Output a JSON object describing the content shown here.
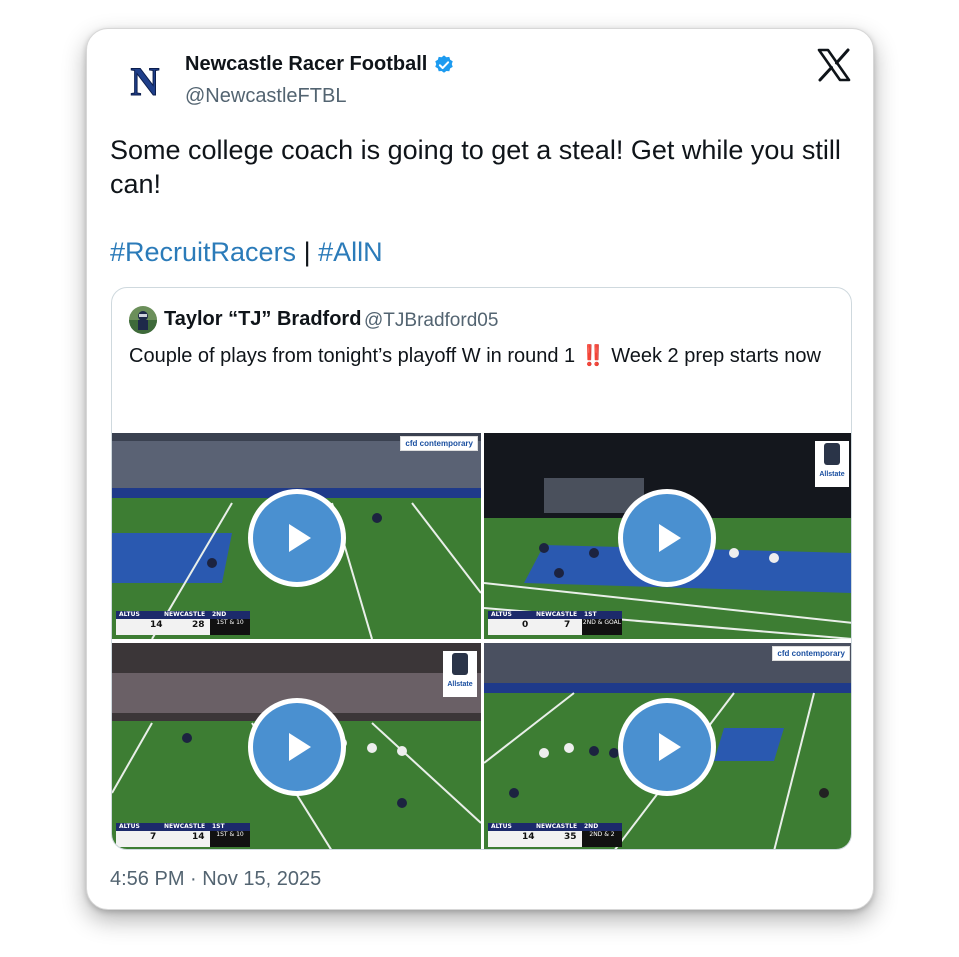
{
  "tweet": {
    "display_name": "Newcastle Racer Football",
    "handle": "@NewcastleFTBL",
    "avatar_letter": "N",
    "verified": true,
    "text": "Some college coach is going to get a steal! Get while you still can!",
    "hashtags": [
      "#RecruitRacers",
      "#AllN"
    ],
    "hashtag_separator": "|",
    "timestamp": "4:56 PM · Nov 15, 2025",
    "platform_icon": "x-logo-icon"
  },
  "quote": {
    "display_name": "Taylor “TJ” Bradford",
    "handle": "@TJBradford05",
    "text_before": "Couple of plays from tonight’s playoff W in round 1",
    "emoji": "‼️",
    "text_after": " Week 2 prep starts now",
    "media": [
      {
        "sponsor": "cfd contemporary",
        "scoreboard": {
          "away": "ALTUS",
          "home": "NEWCASTLE",
          "away_score": "14",
          "home_score": "28",
          "period": "2ND QUARTER",
          "down": "1ST & 10"
        }
      },
      {
        "sponsor": "Allstate",
        "scoreboard": {
          "away": "ALTUS",
          "home": "NEWCASTLE",
          "away_score": "0",
          "home_score": "7",
          "period": "1ST QUARTER",
          "down": "2ND & GOAL"
        }
      },
      {
        "sponsor": "Allstate",
        "scoreboard": {
          "away": "ALTUS",
          "home": "NEWCASTLE",
          "away_score": "7",
          "home_score": "14",
          "period": "1ST QUARTER",
          "down": "1ST & 10"
        }
      },
      {
        "sponsor": "cfd contemporary",
        "scoreboard": {
          "away": "ALTUS",
          "home": "NEWCASTLE",
          "away_score": "14",
          "home_score": "35",
          "period": "2ND QUARTER",
          "down": "2ND & 2"
        }
      }
    ]
  },
  "colors": {
    "link": "#2b7bb9",
    "verified": "#1d9bf0",
    "play_button": "#4a90d0",
    "secondary_text": "#536471"
  }
}
